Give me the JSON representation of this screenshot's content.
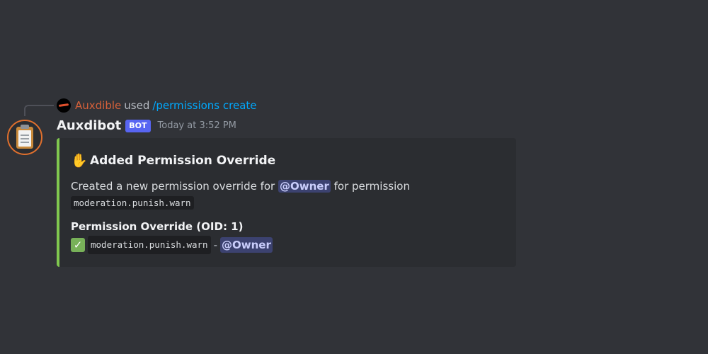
{
  "reply": {
    "user": "Auxdible",
    "used": "used",
    "command": "/permissions create"
  },
  "message": {
    "username": "Auxdibot",
    "bot_tag": "BOT",
    "timestamp": "Today at 3:52 PM"
  },
  "embed": {
    "accent_color": "#80c84f",
    "title_icon": "raised-hand-icon",
    "title": "Added Permission Override",
    "description_prefix": "Created a new permission override for",
    "description_mention": "@Owner",
    "description_suffix": "for permission",
    "description_code": "moderation.punish.warn",
    "field": {
      "name": "Permission Override (OID: 1)",
      "icon": "check-mark-icon",
      "code": "moderation.punish.warn",
      "dash": "-",
      "mention": "@Owner"
    }
  }
}
